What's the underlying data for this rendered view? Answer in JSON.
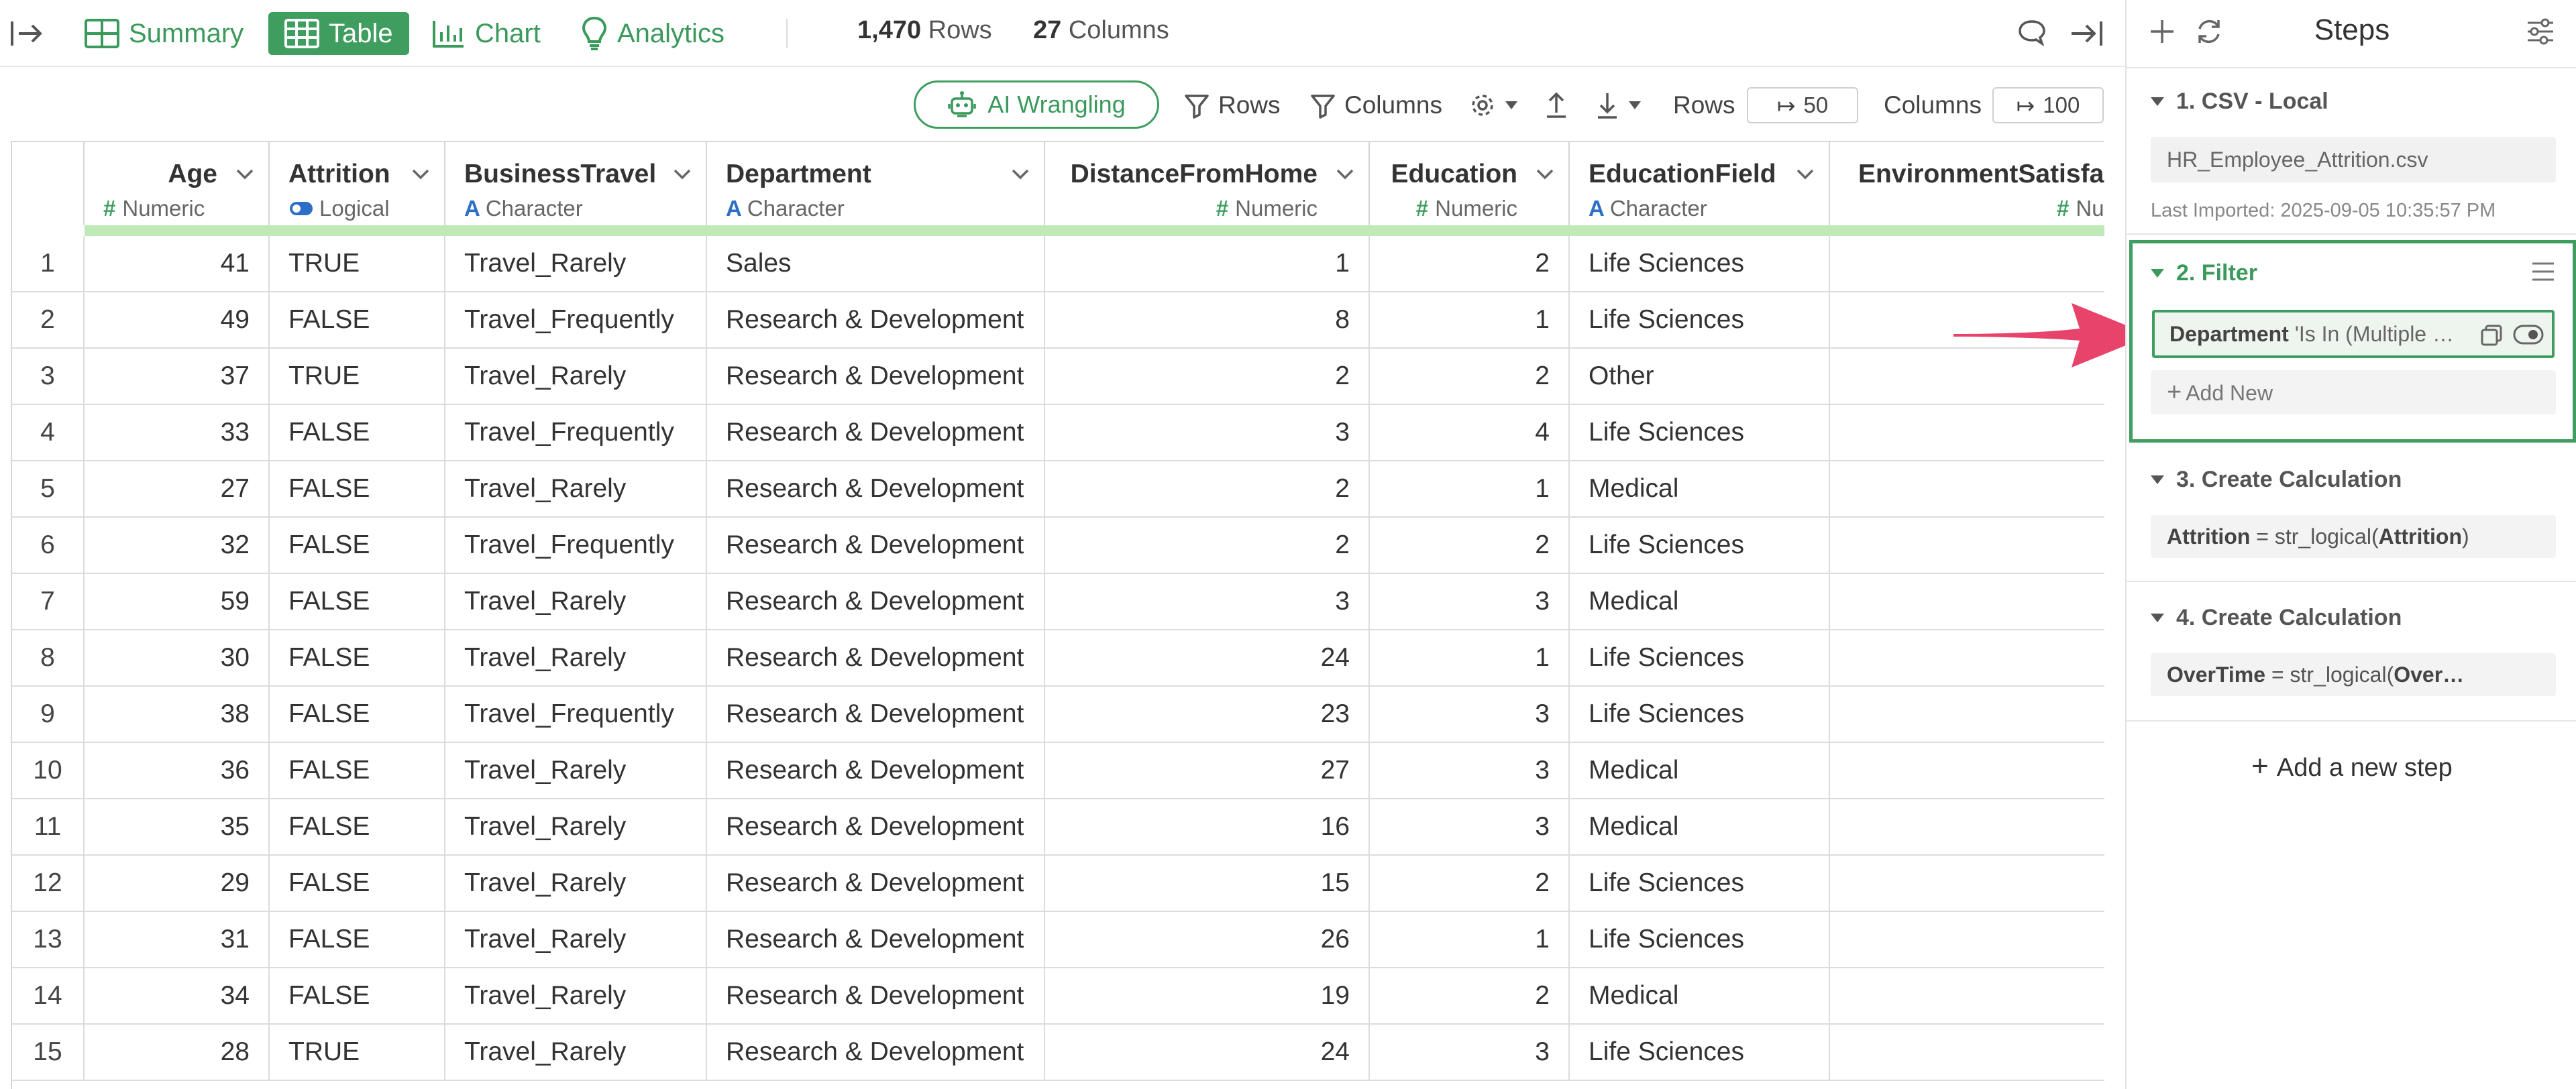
{
  "toolbar": {
    "tabs": [
      {
        "label": "Summary"
      },
      {
        "label": "Table"
      },
      {
        "label": "Chart"
      },
      {
        "label": "Analytics"
      }
    ],
    "rows_count": "1,470",
    "rows_label": "Rows",
    "cols_count": "27",
    "cols_label": "Columns"
  },
  "table_toolbar": {
    "ai_label": "AI Wrangling",
    "rows_filter": "Rows",
    "cols_filter": "Columns",
    "rows_limit_label": "Rows",
    "rows_limit_value": "50",
    "cols_limit_label": "Columns",
    "cols_limit_value": "100"
  },
  "columns": [
    {
      "name": "Age",
      "type": "Numeric",
      "icon": "numeric-icon"
    },
    {
      "name": "Attrition",
      "type": "Logical",
      "icon": "logical-icon"
    },
    {
      "name": "BusinessTravel",
      "type": "Character",
      "icon": "character-icon"
    },
    {
      "name": "Department",
      "type": "Character",
      "icon": "character-icon"
    },
    {
      "name": "DistanceFromHome",
      "type": "Numeric",
      "icon": "numeric-icon"
    },
    {
      "name": "Education",
      "type": "Numeric",
      "icon": "numeric-icon"
    },
    {
      "name": "EducationField",
      "type": "Character",
      "icon": "character-icon"
    },
    {
      "name": "EnvironmentSatisfac",
      "type": "Nu",
      "icon": "numeric-icon"
    }
  ],
  "rows": [
    [
      "1",
      "41",
      "TRUE",
      "Travel_Rarely",
      "Sales",
      "1",
      "2",
      "Life Sciences"
    ],
    [
      "2",
      "49",
      "FALSE",
      "Travel_Frequently",
      "Research & Development",
      "8",
      "1",
      "Life Sciences"
    ],
    [
      "3",
      "37",
      "TRUE",
      "Travel_Rarely",
      "Research & Development",
      "2",
      "2",
      "Other"
    ],
    [
      "4",
      "33",
      "FALSE",
      "Travel_Frequently",
      "Research & Development",
      "3",
      "4",
      "Life Sciences"
    ],
    [
      "5",
      "27",
      "FALSE",
      "Travel_Rarely",
      "Research & Development",
      "2",
      "1",
      "Medical"
    ],
    [
      "6",
      "32",
      "FALSE",
      "Travel_Frequently",
      "Research & Development",
      "2",
      "2",
      "Life Sciences"
    ],
    [
      "7",
      "59",
      "FALSE",
      "Travel_Rarely",
      "Research & Development",
      "3",
      "3",
      "Medical"
    ],
    [
      "8",
      "30",
      "FALSE",
      "Travel_Rarely",
      "Research & Development",
      "24",
      "1",
      "Life Sciences"
    ],
    [
      "9",
      "38",
      "FALSE",
      "Travel_Frequently",
      "Research & Development",
      "23",
      "3",
      "Life Sciences"
    ],
    [
      "10",
      "36",
      "FALSE",
      "Travel_Rarely",
      "Research & Development",
      "27",
      "3",
      "Medical"
    ],
    [
      "11",
      "35",
      "FALSE",
      "Travel_Rarely",
      "Research & Development",
      "16",
      "3",
      "Medical"
    ],
    [
      "12",
      "29",
      "FALSE",
      "Travel_Rarely",
      "Research & Development",
      "15",
      "2",
      "Life Sciences"
    ],
    [
      "13",
      "31",
      "FALSE",
      "Travel_Rarely",
      "Research & Development",
      "26",
      "1",
      "Life Sciences"
    ],
    [
      "14",
      "34",
      "FALSE",
      "Travel_Rarely",
      "Research & Development",
      "19",
      "2",
      "Medical"
    ],
    [
      "15",
      "28",
      "TRUE",
      "Travel_Rarely",
      "Research & Development",
      "24",
      "3",
      "Life Sciences"
    ]
  ],
  "panel": {
    "title": "Steps",
    "step1_title": "1. CSV - Local",
    "step1_file": "HR_Employee_Attrition.csv",
    "step1_imported": "Last Imported: 2025-09-05 10:35:57 PM",
    "step2_title": "2. Filter",
    "step2_field": "Department",
    "step2_rest": " 'Is In (Multiple …",
    "step2_add": "Add New",
    "step3_title": "3. Create Calculation",
    "step3_col": "Attrition",
    "step3_mid": " = str_logical(",
    "step3_arg": "Attrition",
    "step3_end": ")",
    "step4_title": "4. Create Calculation",
    "step4_col": "OverTime",
    "step4_mid": " = str_logical(",
    "step4_arg": "Over…",
    "add_step": "Add a new step"
  },
  "colors": {
    "accent": "#3f9e5f",
    "arrow": "#e8436a",
    "header_bar": "#bfe9b5",
    "numeric_type": "#3f9e5f",
    "character_type": "#2d6fc4",
    "logical_type": "#2d6fc4"
  }
}
